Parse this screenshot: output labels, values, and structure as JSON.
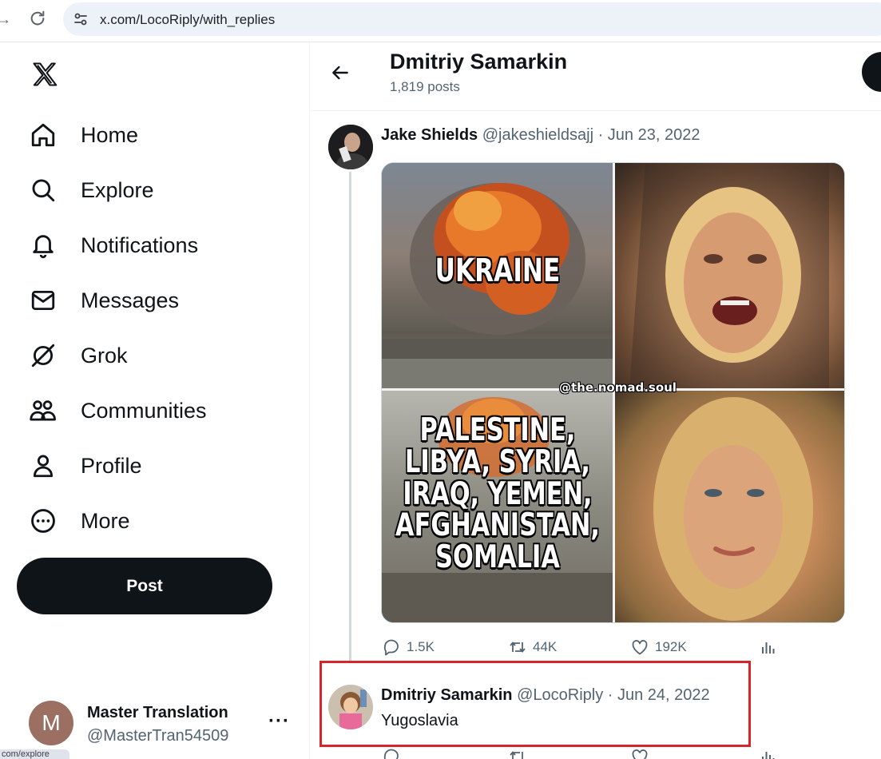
{
  "browser": {
    "url": "x.com/LocoRiply/with_replies",
    "status_tooltip": "com/explore"
  },
  "sidebar": {
    "logo": "x-logo-icon",
    "items": [
      {
        "label": "Home",
        "icon": "home-icon"
      },
      {
        "label": "Explore",
        "icon": "search-icon"
      },
      {
        "label": "Notifications",
        "icon": "bell-icon"
      },
      {
        "label": "Messages",
        "icon": "envelope-icon"
      },
      {
        "label": "Grok",
        "icon": "grok-icon"
      },
      {
        "label": "Communities",
        "icon": "people-icon"
      },
      {
        "label": "Profile",
        "icon": "person-icon"
      },
      {
        "label": "More",
        "icon": "more-circle-icon"
      }
    ],
    "post_button": "Post",
    "account": {
      "avatar_letter": "M",
      "name": "Master Translation",
      "handle": "@MasterTran54509",
      "more": "···"
    }
  },
  "header": {
    "name": "Dmitriy Samarkin",
    "posts": "1,819 posts"
  },
  "tweets": [
    {
      "name": "Jake Shields",
      "handle": "@jakeshieldsajj",
      "date": "· Jun 23, 2022",
      "media": {
        "top_caption": "UKRAINE",
        "bottom_caption": "PALESTINE, LIBYA, SYRIA, IRAQ, YEMEN, AFGHANISTAN, SOMALIA",
        "watermark": "@the.nomad.soul"
      },
      "stats": {
        "replies": "1.5K",
        "reposts": "44K",
        "likes": "192K"
      }
    },
    {
      "name": "Dmitriy Samarkin",
      "handle": "@LocoRiply",
      "date": "· Jun 24, 2022",
      "text": "Yugoslavia"
    }
  ],
  "colors": {
    "highlight_border": "#d8242b",
    "text_primary": "#0f1419",
    "text_secondary": "#536471",
    "post_button_bg": "#0f1419"
  }
}
